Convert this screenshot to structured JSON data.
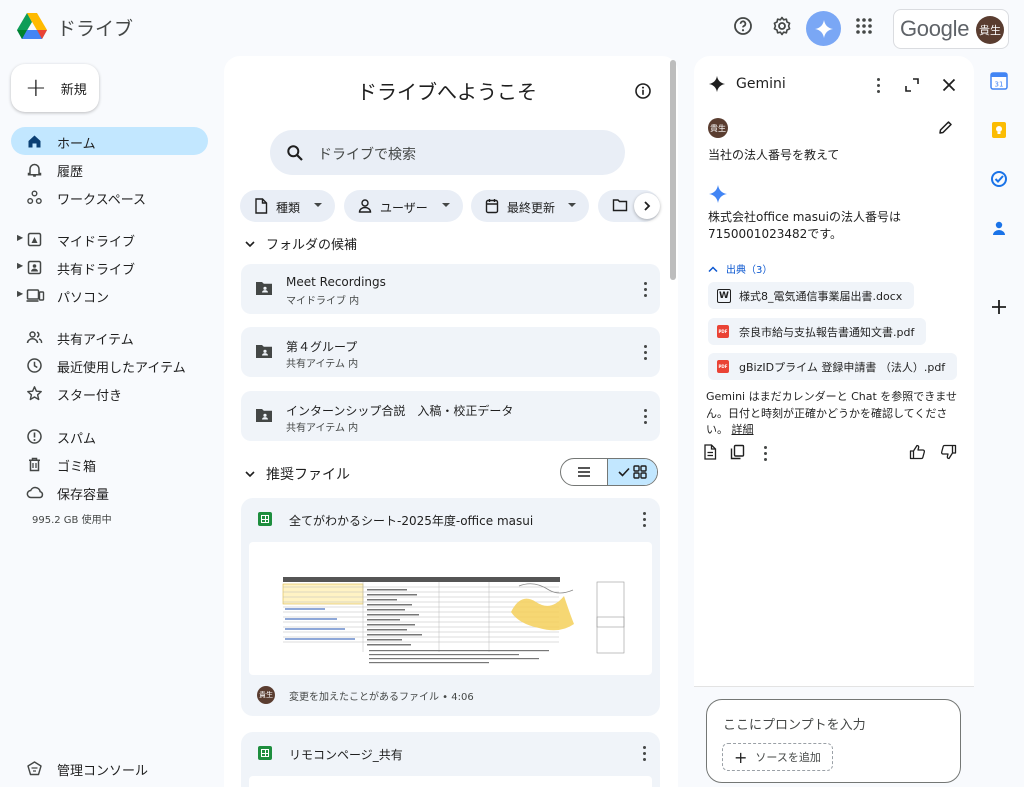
{
  "app": {
    "title": "ドライブ"
  },
  "account": {
    "brand": "Google",
    "avatar_text": "貴生"
  },
  "sidebar": {
    "new_label": "新規",
    "items": [
      {
        "label": "ホーム",
        "icon": "home-icon",
        "active": true
      },
      {
        "label": "履歴",
        "icon": "bell-icon"
      },
      {
        "label": "ワークスペース",
        "icon": "workspaces-icon"
      },
      {
        "label": "マイドライブ",
        "icon": "my-drive-icon",
        "expandable": true
      },
      {
        "label": "共有ドライブ",
        "icon": "shared-drive-icon",
        "expandable": true
      },
      {
        "label": "パソコン",
        "icon": "computer-icon",
        "expandable": true
      },
      {
        "label": "共有アイテム",
        "icon": "shared-people-icon"
      },
      {
        "label": "最近使用したアイテム",
        "icon": "clock-icon"
      },
      {
        "label": "スター付き",
        "icon": "star-icon"
      },
      {
        "label": "スパム",
        "icon": "spam-icon"
      },
      {
        "label": "ゴミ箱",
        "icon": "trash-icon"
      },
      {
        "label": "保存容量",
        "icon": "cloud-icon"
      }
    ],
    "storage_used": "995.2 GB 使用中",
    "admin_console": "管理コンソール"
  },
  "main": {
    "welcome": "ドライブへようこそ",
    "search_placeholder": "ドライブで検索",
    "filters": [
      "種類",
      "ユーザー",
      "最終更新",
      ""
    ],
    "folders_section": "フォルダの候補",
    "folders": [
      {
        "name": "Meet Recordings",
        "location": "マイドライブ 内"
      },
      {
        "name": "第４グループ",
        "location": "共有アイテム 内"
      },
      {
        "name": "インターンシップ合説　入稿・校正データ",
        "location": "共有アイテム 内"
      }
    ],
    "files_section": "推奨ファイル",
    "files": [
      {
        "title": "全てがわかるシート-2025年度-office masui",
        "reason": "変更を加えたことがあるファイル • 4:06",
        "avatar": "貴生"
      },
      {
        "title": "リモコンページ_共有"
      }
    ]
  },
  "gemini": {
    "title": "Gemini",
    "user_avatar": "貴生",
    "user_question": "当社の法人番号を教えて",
    "answer": "株式会社office masuiの法人番号は7150001023482です。",
    "sources_label": "出典（3）",
    "sources": [
      {
        "type": "docx",
        "badge": "W",
        "name": "様式8_電気通信事業届出書.docx"
      },
      {
        "type": "pdf",
        "badge": "PDF",
        "name": "奈良市給与支払報告書通知文書.pdf"
      },
      {
        "type": "pdf",
        "badge": "PDF",
        "name": "gBizIDプライム 登録申請書 （法人）.pdf"
      }
    ],
    "notice": "Gemini はまだカレンダーと Chat を参照できません。日付と時刻が正確かどうかを確認してください。",
    "notice_link": "詳細",
    "prompt_placeholder": "ここにプロンプトを入力",
    "add_source": "ソースを追加"
  },
  "rail": {
    "calendar_day": "31"
  },
  "colors": {
    "accent": "#0b57d0",
    "active_nav": "#c2e7ff",
    "surface": "#f0f4f9",
    "sheets": "#1e8e3e",
    "pdf": "#ea4335"
  }
}
